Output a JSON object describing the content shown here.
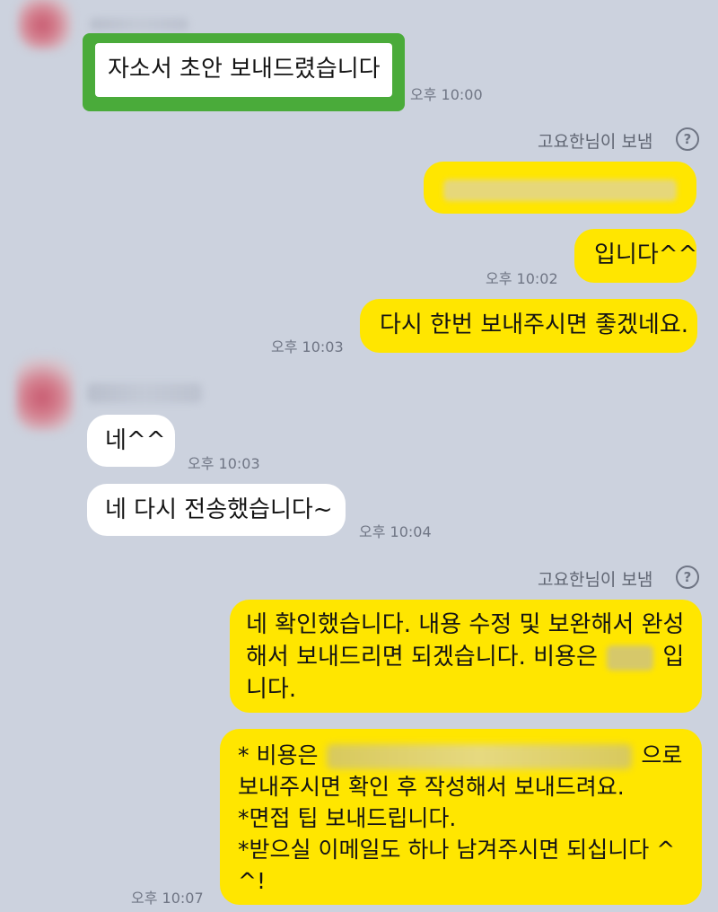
{
  "messages": {
    "m1_text": "자소서 초안 보내드렸습니다",
    "m1_time": "오후 10:00",
    "sent_label_1": "고요한님이 보냄",
    "m3_text": "입니다^^",
    "m3_time": "오후 10:02",
    "m4_text": "다시 한번 보내주시면 좋겠네요.",
    "m4_time": "오후 10:03",
    "m5_text": "네^^",
    "m5_time": "오후 10:03",
    "m6_text": "네 다시 전송했습니다~",
    "m6_time": "오후 10:04",
    "sent_label_2": "고요한님이 보냄",
    "m7_line1": "네 확인했습니다. 내용 수정 및 보완해서 완성",
    "m7_line2a": "해서 보내드리면 되겠습니다. 비용은",
    "m7_line2b": "입",
    "m7_line3": "니다.",
    "m8_line1a": "* 비용은",
    "m8_line1b": "으로",
    "m8_line2": "보내주시면 확인 후 작성해서 보내드려요.",
    "m8_line3": "*면접 팁 보내드립니다.",
    "m8_line4": "*받으실 이메일도 하나 남겨주시면 되십니다 ^",
    "m8_line5": "^!",
    "m8_time": "오후 10:07"
  },
  "icons": {
    "help": "question-circle-icon",
    "help_glyph": "?"
  },
  "colors": {
    "background": "#ccd2de",
    "outgoing_bubble": "#ffe600",
    "incoming_bubble": "#ffffff",
    "highlight_border": "#4aab3a"
  }
}
